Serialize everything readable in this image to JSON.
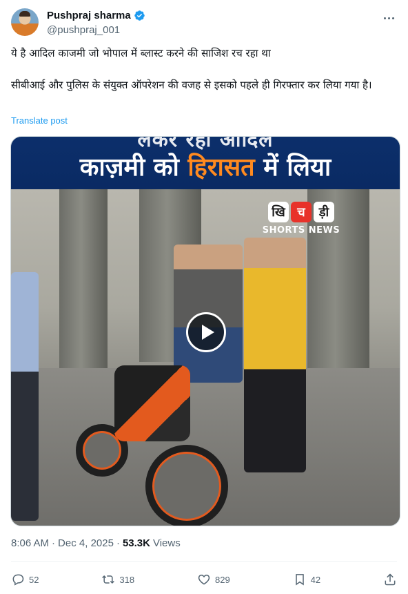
{
  "author": {
    "display_name": "Pushpraj sharma",
    "handle": "@pushpraj_001",
    "verified": true
  },
  "tweet": {
    "line1": "ये है आदिल काजमी जो भोपाल में ब्लास्ट करने की साजिश रच रहा था",
    "line2": "सीबीआई और पुलिस के संयुक्त ऑपरेशन की वजह से इसको पहले ही गिरफ्तार कर लिया गया है।",
    "translate_label": "Translate post"
  },
  "media": {
    "banner_top": "लेकर रहा आदिल",
    "banner_part1": "काज़मी को ",
    "banner_highlight": "हिरासत",
    "banner_part2": " में लिया",
    "logo_letters": [
      "खि",
      "च",
      "ड़ी"
    ],
    "logo_sub": "SHORTS NEWS"
  },
  "meta": {
    "time": "8:06 AM",
    "separator": "·",
    "date": "Dec 4, 2025",
    "views_count": "53.3K",
    "views_label": "Views"
  },
  "actions": {
    "replies": "52",
    "reposts": "318",
    "likes": "829",
    "bookmarks": "42"
  },
  "colors": {
    "accent": "#1d9bf0",
    "secondary_text": "#536471",
    "primary_text": "#0f1419",
    "banner_bg": "#0c2f6b",
    "banner_highlight": "#ff8a1f"
  },
  "icons": [
    "verified-badge-icon",
    "more-icon",
    "play-icon",
    "reply-icon",
    "repost-icon",
    "like-icon",
    "bookmark-icon",
    "share-icon"
  ]
}
